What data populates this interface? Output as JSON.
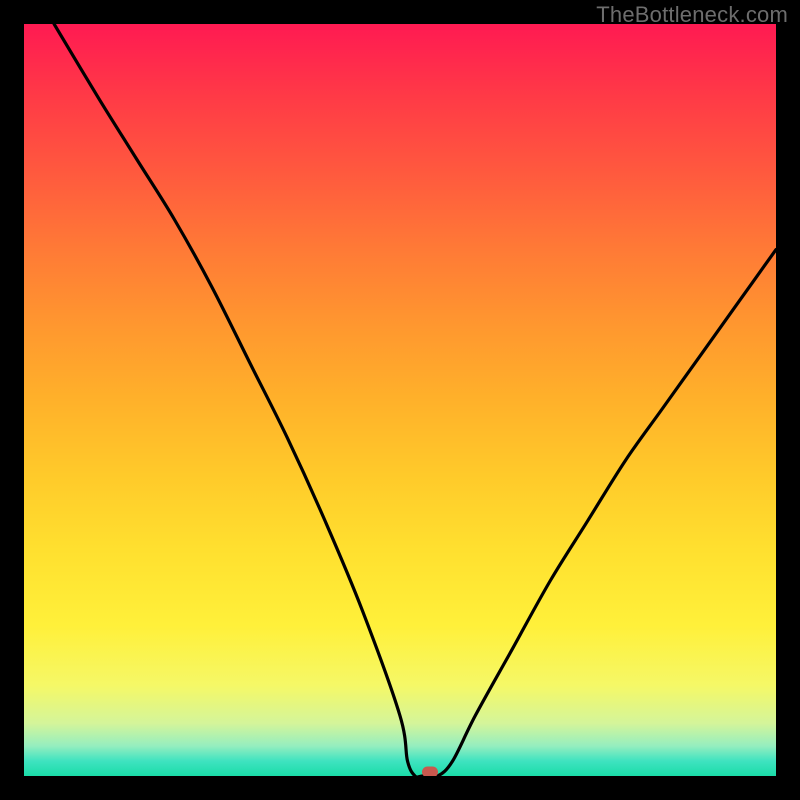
{
  "watermark": "TheBottleneck.com",
  "colors": {
    "background": "#000000",
    "curve": "#000000",
    "marker": "#c8584e",
    "gradient_top": "#ff1a52",
    "gradient_bottom": "#1adca8"
  },
  "chart_data": {
    "type": "line",
    "title": "",
    "xlabel": "",
    "ylabel": "",
    "xlim": [
      0,
      100
    ],
    "ylim": [
      0,
      100
    ],
    "grid": false,
    "legend": false,
    "series": [
      {
        "name": "bottleneck-curve",
        "x": [
          4,
          10,
          15,
          20,
          25,
          30,
          35,
          40,
          45,
          50,
          51,
          52,
          53,
          55,
          57,
          60,
          65,
          70,
          75,
          80,
          85,
          90,
          95,
          100
        ],
        "y": [
          100,
          90,
          82,
          74,
          65,
          55,
          45,
          34,
          22,
          8,
          2,
          0,
          0,
          0,
          2,
          8,
          17,
          26,
          34,
          42,
          49,
          56,
          63,
          70
        ]
      }
    ],
    "marker": {
      "x": 54,
      "y": 0
    },
    "annotations": []
  }
}
